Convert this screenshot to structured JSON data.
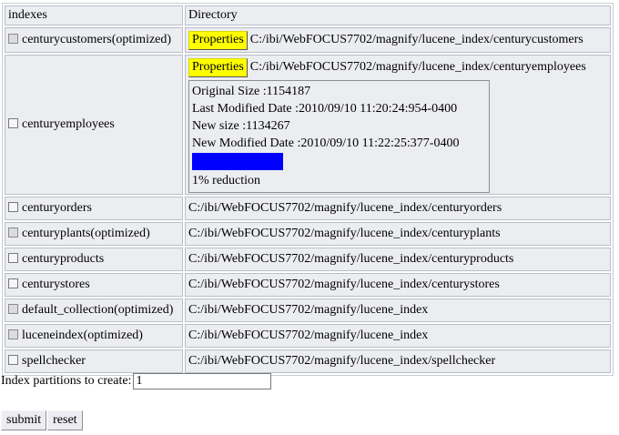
{
  "table": {
    "header_indexes": "indexes",
    "header_directory": "Directory",
    "properties_label": "Properties",
    "rows": [
      {
        "name": "centurycustomers(optimized)",
        "path": "C:/ibi/WebFOCUS7702/magnify/lucene_index/centurycustomers"
      },
      {
        "name": "centuryemployees",
        "path": "C:/ibi/WebFOCUS7702/magnify/lucene_index/centuryemployees"
      },
      {
        "name": "centuryorders",
        "path": "C:/ibi/WebFOCUS7702/magnify/lucene_index/centuryorders"
      },
      {
        "name": "centuryplants(optimized)",
        "path": "C:/ibi/WebFOCUS7702/magnify/lucene_index/centuryplants"
      },
      {
        "name": "centuryproducts",
        "path": "C:/ibi/WebFOCUS7702/magnify/lucene_index/centuryproducts"
      },
      {
        "name": "centurystores",
        "path": "C:/ibi/WebFOCUS7702/magnify/lucene_index/centurystores"
      },
      {
        "name": "default_collection(optimized)",
        "path": "C:/ibi/WebFOCUS7702/magnify/lucene_index"
      },
      {
        "name": "luceneindex(optimized)",
        "path": "C:/ibi/WebFOCUS7702/magnify/lucene_index"
      },
      {
        "name": "spellchecker",
        "path": "C:/ibi/WebFOCUS7702/magnify/lucene_index/spellchecker"
      }
    ]
  },
  "properties_panel": {
    "original_size": "Original Size :1154187",
    "last_modified": "Last Modified Date :2010/09/10 11:20:24:954-0400",
    "new_size": "New size :1134267",
    "new_modified": "New Modified Date :2010/09/10 11:22:25:377-0400",
    "reduction_label": "1% reduction",
    "bar_color": "#0000ff"
  },
  "form": {
    "partitions_label": "Index partitions to create:",
    "partitions_value": "1",
    "submit_label": "submit",
    "reset_label": "reset"
  },
  "colors": {
    "cell_bg": "#ecedf1",
    "properties_button": "#ffff00"
  }
}
